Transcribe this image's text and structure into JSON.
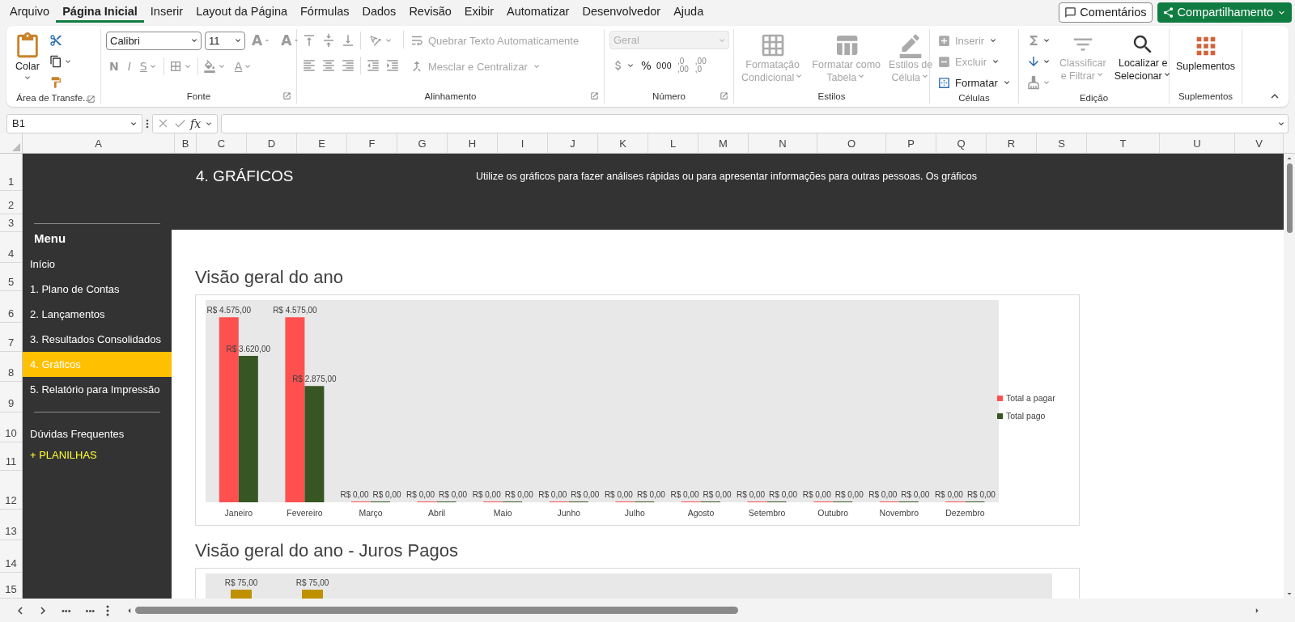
{
  "menu_tabs": [
    {
      "label": "Arquivo",
      "selected": false
    },
    {
      "label": "Página Inicial",
      "selected": true
    },
    {
      "label": "Inserir",
      "selected": false
    },
    {
      "label": "Layout da Página",
      "selected": false
    },
    {
      "label": "Fórmulas",
      "selected": false
    },
    {
      "label": "Dados",
      "selected": false
    },
    {
      "label": "Revisão",
      "selected": false
    },
    {
      "label": "Exibir",
      "selected": false
    },
    {
      "label": "Automatizar",
      "selected": false
    },
    {
      "label": "Desenvolvedor",
      "selected": false
    },
    {
      "label": "Ajuda",
      "selected": false
    }
  ],
  "comments_button": "Comentários",
  "share_button": "Compartilhamento",
  "ribbon": {
    "clipboard": {
      "label": "Área de Transfe...",
      "paste": "Colar"
    },
    "font": {
      "label": "Fonte",
      "font_name": "Calibri",
      "font_size": "11",
      "grow": "A",
      "shrink": "A",
      "bold": "N",
      "italic": "I",
      "underline": "S",
      "font_color": "A"
    },
    "alignment": {
      "label": "Alinhamento",
      "wrap": {
        "label": "Quebrar Texto Automaticamente",
        "disabled": true
      },
      "merge": {
        "label": "Mesclar e Centralizar",
        "disabled": true
      }
    },
    "number": {
      "label": "Número",
      "format": {
        "value": "Geral",
        "disabled": true
      },
      "percent": "%",
      "thousands": "000",
      "decimals": [
        {
          "top": ",0",
          "bottom": ",00"
        },
        {
          "top": ",00",
          "bottom": ",0"
        }
      ]
    },
    "styles": {
      "label": "Estilos",
      "items": [
        {
          "lines": [
            "Formatação",
            "Condicional"
          ],
          "disabled": true
        },
        {
          "lines": [
            "Formatar como",
            "Tabela"
          ],
          "disabled": true
        },
        {
          "lines": [
            "Estilos de",
            "Célula"
          ],
          "disabled": true
        }
      ]
    },
    "cells": {
      "label": "Células",
      "items": [
        {
          "label": "Inserir",
          "disabled": true
        },
        {
          "label": "Excluir",
          "disabled": true
        },
        {
          "label": "Formatar",
          "disabled": false
        }
      ]
    },
    "editing": {
      "label": "Edição",
      "sort": {
        "lines": [
          "Classificar",
          "e Filtrar"
        ],
        "disabled": true
      },
      "find": {
        "lines": [
          "Localizar e",
          "Selecionar"
        ],
        "disabled": false
      }
    },
    "addins": {
      "label": "Suplementos",
      "button": "Suplementos"
    }
  },
  "formula_bar": {
    "name_box": "B1",
    "fx": "fx"
  },
  "columns": [
    "A",
    "B",
    "C",
    "D",
    "E",
    "F",
    "G",
    "H",
    "I",
    "J",
    "K",
    "L",
    "M",
    "N",
    "O",
    "P",
    "Q",
    "R",
    "S",
    "T",
    "U",
    "V"
  ],
  "rows": [
    "1",
    "2",
    "3",
    "4",
    "5",
    "6",
    "7",
    "8",
    "9",
    "10",
    "11",
    "12",
    "13",
    "14",
    "15"
  ],
  "sheet": {
    "title": "4. GRÁFICOS",
    "description": "Utilize os gráficos para fazer análises rápidas ou para apresentar informações para outras pessoas. Os gráficos",
    "menu_title": "Menu",
    "menu_groups": [
      [
        {
          "label": "Início",
          "kind": "page",
          "selected": false
        },
        {
          "label": "1. Plano de Contas",
          "kind": "page",
          "selected": false
        },
        {
          "label": "2. Lançamentos",
          "kind": "page",
          "selected": false
        },
        {
          "label": "3. Resultados Consolidados",
          "kind": "page",
          "selected": false
        },
        {
          "label": "4. Gráficos",
          "kind": "page",
          "selected": true
        },
        {
          "label": "5. Relatório para Impressão",
          "kind": "page",
          "selected": false
        }
      ],
      [
        {
          "label": "Dúvidas Frequentes",
          "kind": "page",
          "selected": false
        },
        {
          "label": "+ PLANILHAS",
          "kind": "promo",
          "selected": false
        }
      ]
    ],
    "charts": [
      {
        "heading": "Visão geral do ano",
        "chart_data": {
          "type": "bar",
          "legend": "right",
          "categories": [
            "Janeiro",
            "Fevereiro",
            "Março",
            "Abril",
            "Maio",
            "Junho",
            "Julho",
            "Agosto",
            "Setembro",
            "Outubro",
            "Novembro",
            "Dezembro"
          ],
          "data_labels": true,
          "series": [
            {
              "name": "Total a pagar",
              "color": "#ff5050",
              "values": [
                4575,
                4575,
                0,
                0,
                0,
                0,
                0,
                0,
                0,
                0,
                0,
                0
              ],
              "value_labels": [
                "R$ 4.575,00",
                "R$ 4.575,00",
                "R$ 0,00",
                "R$ 0,00",
                "R$ 0,00",
                "R$ 0,00",
                "R$ 0,00",
                "R$ 0,00",
                "R$ 0,00",
                "R$ 0,00",
                "R$ 0,00",
                "R$ 0,00"
              ]
            },
            {
              "name": "Total pago",
              "color": "#375623",
              "values": [
                3620,
                2875,
                0,
                0,
                0,
                0,
                0,
                0,
                0,
                0,
                0,
                0
              ],
              "value_labels": [
                "R$ 3.620,00",
                "R$ 2.875,00",
                "R$ 0,00",
                "R$ 0,00",
                "R$ 0,00",
                "R$ 0,00",
                "R$ 0,00",
                "R$ 0,00",
                "R$ 0,00",
                "R$ 0,00",
                "R$ 0,00",
                "R$ 0,00"
              ]
            }
          ]
        }
      },
      {
        "heading": "Visão geral do ano - Juros Pagos",
        "chart_data": {
          "type": "bar",
          "data_labels": true,
          "series": [
            {
              "color": "#bf9000",
              "values": [
                75,
                75
              ],
              "value_labels": [
                "R$ 75,00",
                "R$ 75,00"
              ]
            }
          ]
        }
      }
    ]
  },
  "sheet_nav": {
    "more_left": "•••",
    "more_right": "•••"
  }
}
